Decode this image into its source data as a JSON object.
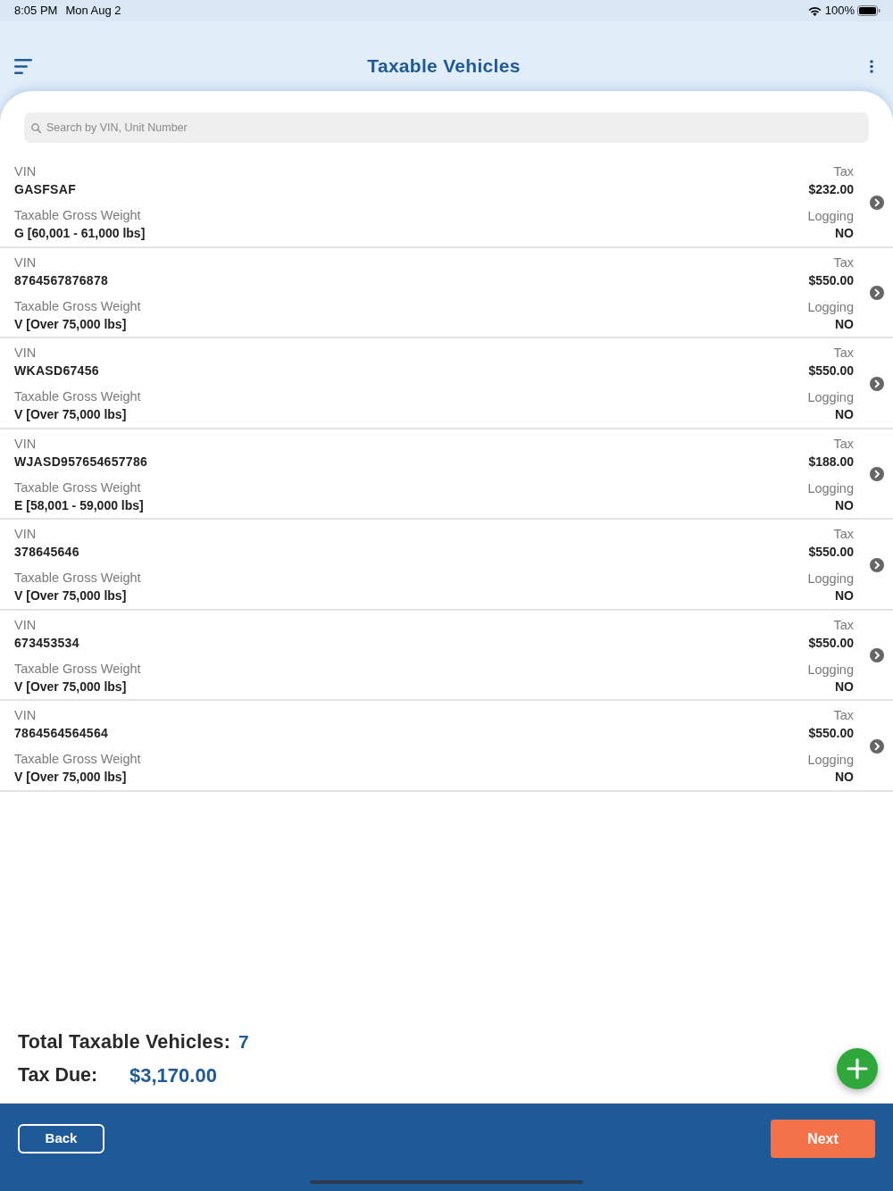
{
  "status_bar": {
    "time": "8:05 PM",
    "date": "Mon Aug 2",
    "battery": "100%"
  },
  "header": {
    "title": "Taxable Vehicles"
  },
  "search": {
    "placeholder": "Search by VIN, Unit Number"
  },
  "vehicles": [
    {
      "vin_label": "VIN",
      "vin": "GASFSAF",
      "weight_label": "Taxable Gross Weight",
      "weight": "G [60,001 - 61,000 lbs]",
      "tax_label": "Tax",
      "tax": "$232.00",
      "logging_label": "Logging",
      "logging": "NO"
    },
    {
      "vin_label": "VIN",
      "vin": "8764567876878",
      "weight_label": "Taxable Gross Weight",
      "weight": "V [Over 75,000 lbs]",
      "tax_label": "Tax",
      "tax": "$550.00",
      "logging_label": "Logging",
      "logging": "NO"
    },
    {
      "vin_label": "VIN",
      "vin": "WKASD67456",
      "weight_label": "Taxable Gross Weight",
      "weight": "V [Over 75,000 lbs]",
      "tax_label": "Tax",
      "tax": "$550.00",
      "logging_label": "Logging",
      "logging": "NO"
    },
    {
      "vin_label": "VIN",
      "vin": "WJASD957654657786",
      "weight_label": "Taxable Gross Weight",
      "weight": "E [58,001 - 59,000 lbs]",
      "tax_label": "Tax",
      "tax": "$188.00",
      "logging_label": "Logging",
      "logging": "NO"
    },
    {
      "vin_label": "VIN",
      "vin": "378645646",
      "weight_label": "Taxable Gross Weight",
      "weight": "V [Over 75,000 lbs]",
      "tax_label": "Tax",
      "tax": "$550.00",
      "logging_label": "Logging",
      "logging": "NO"
    },
    {
      "vin_label": "VIN",
      "vin": "673453534",
      "weight_label": "Taxable Gross Weight",
      "weight": "V [Over 75,000 lbs]",
      "tax_label": "Tax",
      "tax": "$550.00",
      "logging_label": "Logging",
      "logging": "NO"
    },
    {
      "vin_label": "VIN",
      "vin": "7864564564564",
      "weight_label": "Taxable Gross Weight",
      "weight": "V [Over 75,000 lbs]",
      "tax_label": "Tax",
      "tax": "$550.00",
      "logging_label": "Logging",
      "logging": "NO"
    }
  ],
  "summary": {
    "total_label": "Total Taxable Vehicles:",
    "total": "7",
    "tax_due_label": "Tax Due:",
    "tax_due": "$3,170.00"
  },
  "footer": {
    "back": "Back",
    "next": "Next"
  }
}
